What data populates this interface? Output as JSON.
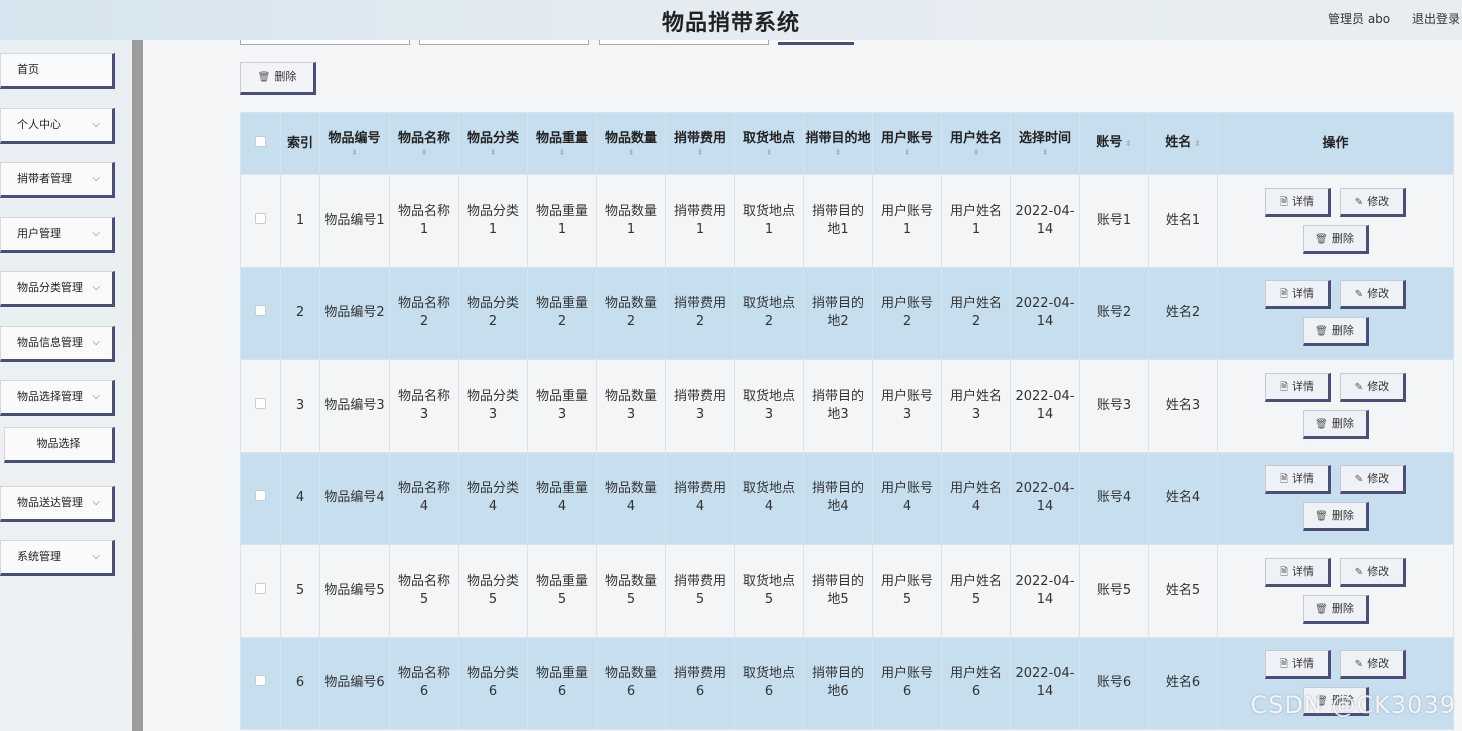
{
  "header": {
    "title": "物品捎带系统",
    "user_label": "管理员 abo",
    "logout": "退出登录"
  },
  "sidebar": {
    "items": [
      {
        "label": "首页",
        "has_chevron": false
      },
      {
        "label": "个人中心",
        "has_chevron": true
      },
      {
        "label": "捎带者管理",
        "has_chevron": true
      },
      {
        "label": "用户管理",
        "has_chevron": true
      },
      {
        "label": "物品分类管理",
        "has_chevron": true
      },
      {
        "label": "物品信息管理",
        "has_chevron": true
      },
      {
        "label": "物品选择管理",
        "has_chevron": true
      },
      {
        "label": "物品送达管理",
        "has_chevron": true
      },
      {
        "label": "系统管理",
        "has_chevron": true
      }
    ],
    "sub_item": "物品选择"
  },
  "toolbar": {
    "batch_delete": "删除"
  },
  "table": {
    "columns": [
      "索引",
      "物品编号",
      "物品名称",
      "物品分类",
      "物品重量",
      "物品数量",
      "捎带费用",
      "取货地点",
      "捎带目的地",
      "用户账号",
      "用户姓名",
      "选择时间",
      "账号",
      "姓名",
      "操作"
    ],
    "actions": {
      "detail": "详情",
      "edit": "修改",
      "delete": "删除"
    },
    "rows": [
      {
        "index": "1",
        "code": "物品编号1",
        "name": "物品名称1",
        "category": "物品分类1",
        "weight": "物品重量1",
        "qty": "物品数量1",
        "fee": "捎带费用1",
        "pickup": "取货地点1",
        "dest": "捎带目的地1",
        "user_acct": "用户账号1",
        "user_name": "用户姓名1",
        "time": "2022-04-14",
        "acct": "账号1",
        "person": "姓名1"
      },
      {
        "index": "2",
        "code": "物品编号2",
        "name": "物品名称2",
        "category": "物品分类2",
        "weight": "物品重量2",
        "qty": "物品数量2",
        "fee": "捎带费用2",
        "pickup": "取货地点2",
        "dest": "捎带目的地2",
        "user_acct": "用户账号2",
        "user_name": "用户姓名2",
        "time": "2022-04-14",
        "acct": "账号2",
        "person": "姓名2"
      },
      {
        "index": "3",
        "code": "物品编号3",
        "name": "物品名称3",
        "category": "物品分类3",
        "weight": "物品重量3",
        "qty": "物品数量3",
        "fee": "捎带费用3",
        "pickup": "取货地点3",
        "dest": "捎带目的地3",
        "user_acct": "用户账号3",
        "user_name": "用户姓名3",
        "time": "2022-04-14",
        "acct": "账号3",
        "person": "姓名3"
      },
      {
        "index": "4",
        "code": "物品编号4",
        "name": "物品名称4",
        "category": "物品分类4",
        "weight": "物品重量4",
        "qty": "物品数量4",
        "fee": "捎带费用4",
        "pickup": "取货地点4",
        "dest": "捎带目的地4",
        "user_acct": "用户账号4",
        "user_name": "用户姓名4",
        "time": "2022-04-14",
        "acct": "账号4",
        "person": "姓名4"
      },
      {
        "index": "5",
        "code": "物品编号5",
        "name": "物品名称5",
        "category": "物品分类5",
        "weight": "物品重量5",
        "qty": "物品数量5",
        "fee": "捎带费用5",
        "pickup": "取货地点5",
        "dest": "捎带目的地5",
        "user_acct": "用户账号5",
        "user_name": "用户姓名5",
        "time": "2022-04-14",
        "acct": "账号5",
        "person": "姓名5"
      },
      {
        "index": "6",
        "code": "物品编号6",
        "name": "物品名称6",
        "category": "物品分类6",
        "weight": "物品重量6",
        "qty": "物品数量6",
        "fee": "捎带费用6",
        "pickup": "取货地点6",
        "dest": "捎带目的地6",
        "user_acct": "用户账号6",
        "user_name": "用户姓名6",
        "time": "2022-04-14",
        "acct": "账号6",
        "person": "姓名6"
      }
    ]
  },
  "watermark": "CSDN @CK3039",
  "colors": {
    "header_bg": "#d5e4ee",
    "row_highlight": "#c6deee",
    "button_shadow": "#4a4f7a",
    "sidebar_strip": "#9c9c9c"
  }
}
